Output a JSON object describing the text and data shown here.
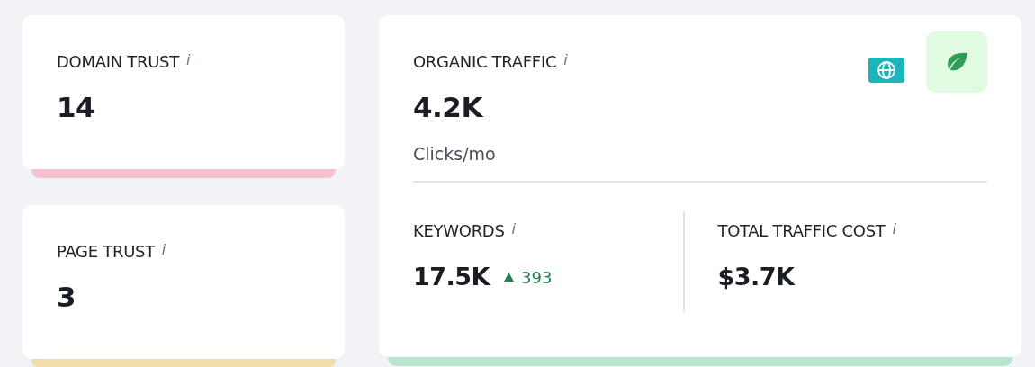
{
  "trust_cards": [
    {
      "title": "DOMAIN TRUST",
      "info": "i",
      "value": "14",
      "color": "#f4c1d2"
    },
    {
      "title": "PAGE TRUST",
      "info": "i",
      "value": "3",
      "color": "#f0ddaa"
    }
  ],
  "traffic_card": {
    "title": "ORGANIC TRAFFIC",
    "info": "i",
    "value": "4.2K",
    "unit": "Clicks/mo",
    "color": "#b8e5cd",
    "metrics": [
      {
        "title": "KEYWORDS",
        "info": "i",
        "value": "17.5K",
        "change": "393"
      },
      {
        "title": "TOTAL TRAFFIC COST",
        "info": "i",
        "value": "$3.7K"
      }
    ]
  }
}
